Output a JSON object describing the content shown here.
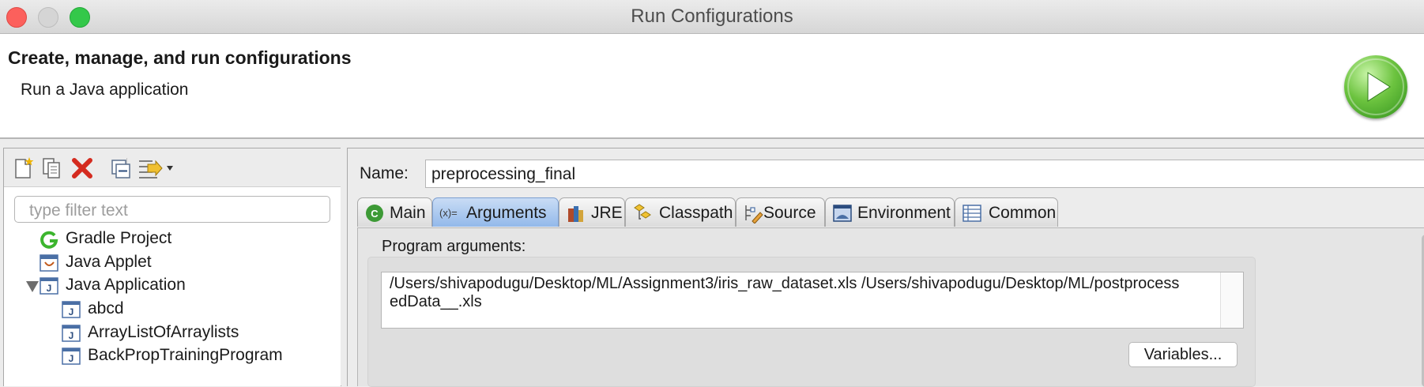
{
  "window": {
    "title": "Run Configurations"
  },
  "header": {
    "title": "Create, manage, and run configurations",
    "subtitle": "Run a Java application",
    "icon": "run-play-icon"
  },
  "left": {
    "toolbar": [
      "new-configuration-icon",
      "duplicate-icon",
      "delete-icon",
      "collapse-all-icon",
      "filter-icon"
    ],
    "filter_placeholder": "type filter text",
    "tree": [
      {
        "label": "Gradle Project",
        "icon": "gradle-icon"
      },
      {
        "label": "Java Applet",
        "icon": "java-applet-icon"
      },
      {
        "label": "Java Application",
        "icon": "java-app-icon",
        "expanded": true
      },
      {
        "label": "abcd",
        "icon": "java-file-icon"
      },
      {
        "label": "ArrayListOfArraylists",
        "icon": "java-file-icon"
      },
      {
        "label": "BackPropTrainingProgram",
        "icon": "java-file-icon"
      }
    ]
  },
  "right": {
    "name_label": "Name:",
    "name_value": "preprocessing_final",
    "tabs": [
      {
        "label": "Main",
        "icon": "main-class-icon"
      },
      {
        "label": "Arguments",
        "icon": "arguments-icon",
        "active": true
      },
      {
        "label": "JRE",
        "icon": "jre-icon"
      },
      {
        "label": "Classpath",
        "icon": "classpath-icon"
      },
      {
        "label": "Source",
        "icon": "source-icon"
      },
      {
        "label": "Environment",
        "icon": "environment-icon"
      },
      {
        "label": "Common",
        "icon": "common-icon"
      }
    ],
    "program_args_label": "Program arguments:",
    "program_args_value": "/Users/shivapodugu/Desktop/ML/Assignment3/iris_raw_dataset.xls /Users/shivapodugu/Desktop/ML/postprocessedData__.xls",
    "variables_label": "Variables..."
  }
}
